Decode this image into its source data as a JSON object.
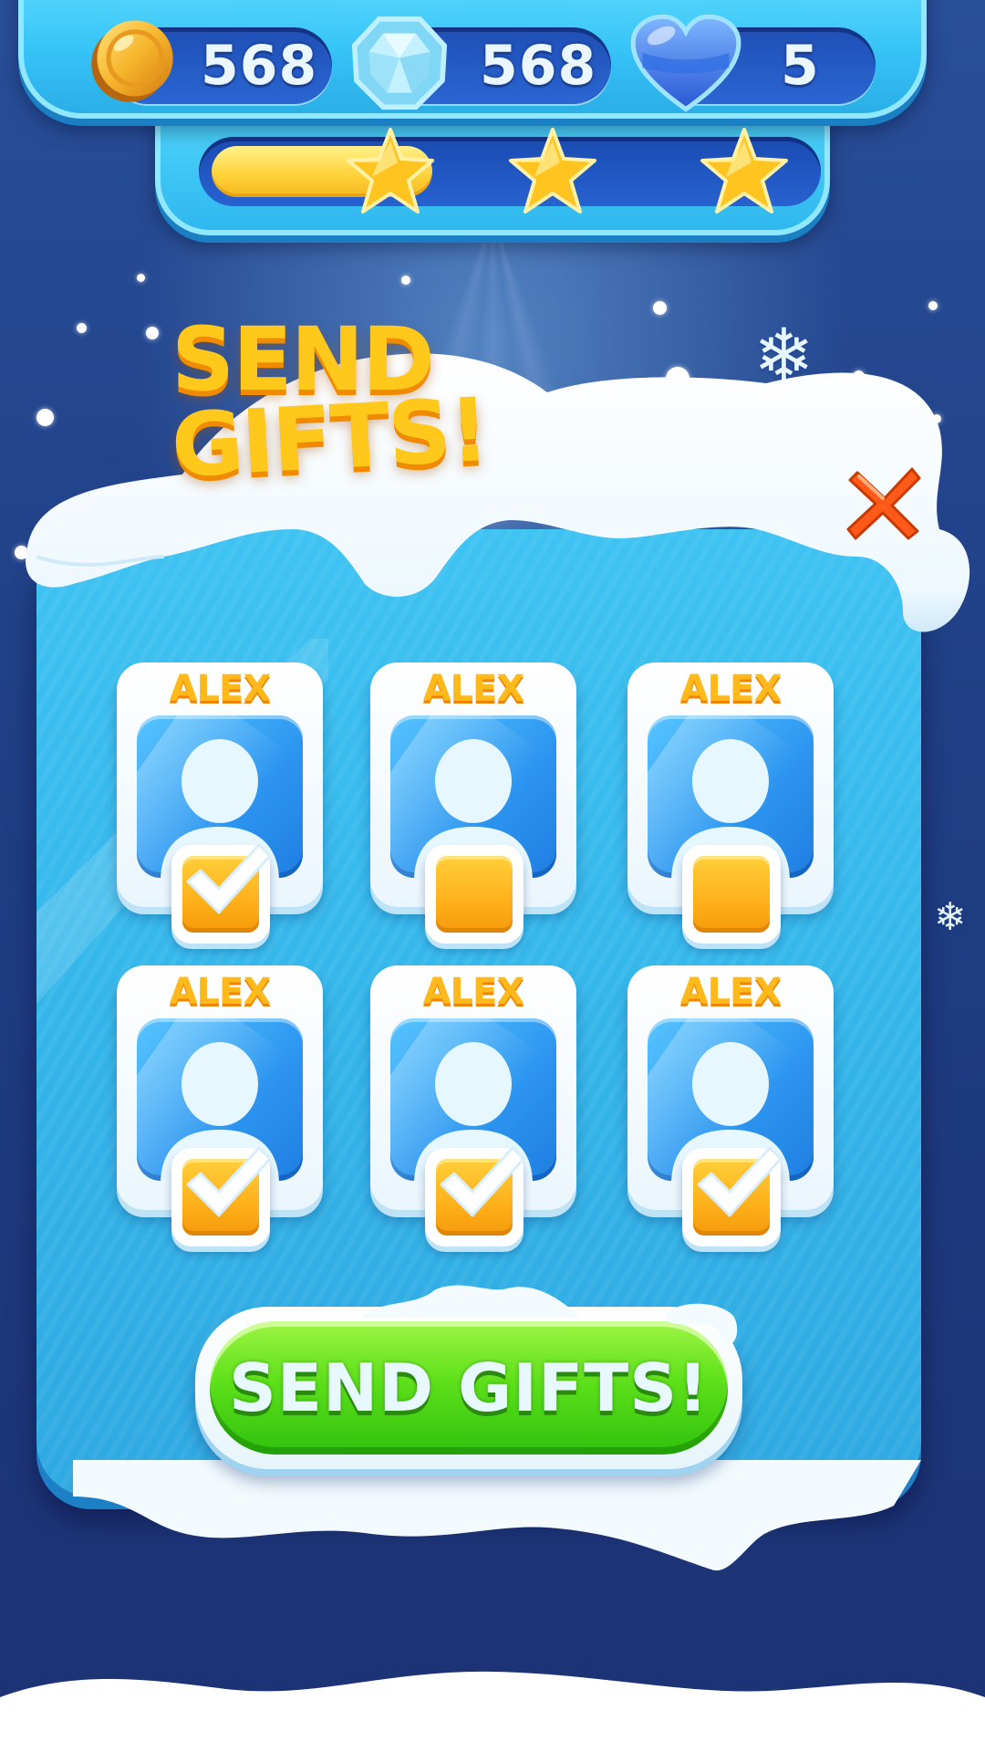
{
  "hud": {
    "coins": "568",
    "gems": "568",
    "lives": "5",
    "progress_fraction": 0.37,
    "stars_total": 3,
    "icons": [
      "coin-icon",
      "gem-icon",
      "heart-icon",
      "star-icon"
    ]
  },
  "dialog": {
    "title_line1": "SEND",
    "title_line2": "GIFTS!",
    "close_icon": "close-icon"
  },
  "friends": [
    {
      "name": "ALEX",
      "checked": true
    },
    {
      "name": "ALEX",
      "checked": false
    },
    {
      "name": "ALEX",
      "checked": false
    },
    {
      "name": "ALEX",
      "checked": true
    },
    {
      "name": "ALEX",
      "checked": true
    },
    {
      "name": "ALEX",
      "checked": true
    }
  ],
  "send_button": {
    "label": "SEND GIFTS!"
  },
  "colors": {
    "background": "#203f86",
    "panel": "#34b6ea",
    "hud": "#37c4f7",
    "title": "#ffc81a",
    "button_green": "#5ee01a",
    "checkbox_orange": "#ffb01a",
    "close_red": "#ff5a1a"
  }
}
